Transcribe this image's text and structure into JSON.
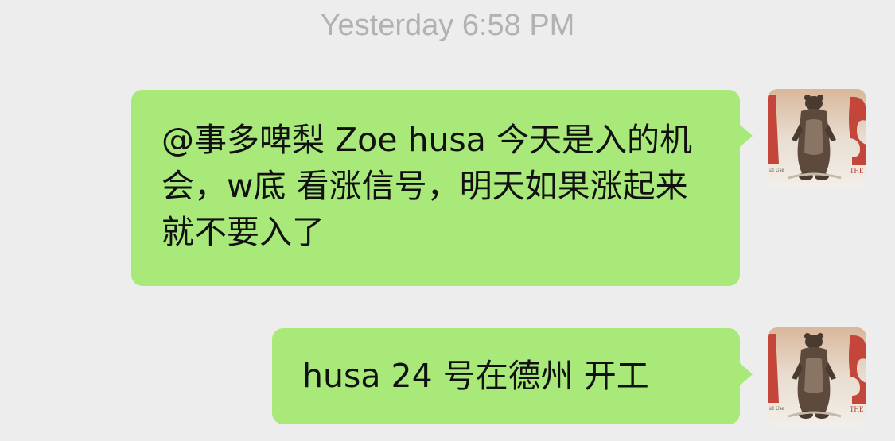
{
  "chat": {
    "timestamp": "Yesterday 6:58 PM",
    "messages": [
      {
        "text": "@事多啤梨 Zoe husa 今天是入的机会，w底 看涨信号，明天如果涨起来就不要入了",
        "sender": "self"
      },
      {
        "text": "husa 24 号在德州 开工",
        "sender": "self"
      }
    ],
    "avatar": {
      "icon": "bear-avatar-icon",
      "text_left": "ial Use",
      "text_right": "THE"
    }
  },
  "colors": {
    "background": "#ededed",
    "bubble": "#a9e97a",
    "timestamp": "#b2b2b2"
  }
}
